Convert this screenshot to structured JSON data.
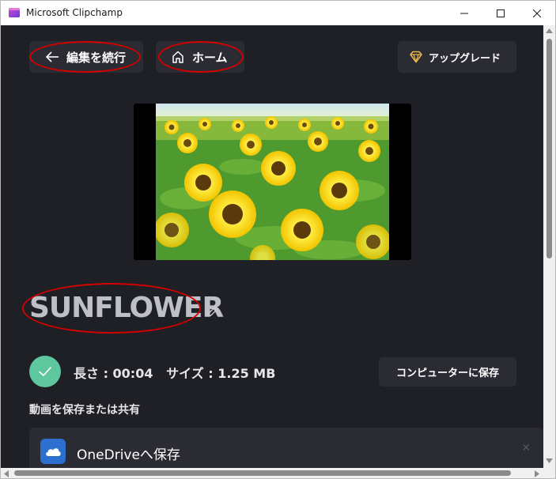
{
  "window": {
    "title": "Microsoft Clipchamp"
  },
  "toolbar": {
    "back_label": "編集を続行",
    "home_label": "ホーム",
    "upgrade_label": "アップグレード"
  },
  "project": {
    "name": "SUNFLOWER"
  },
  "export_info": {
    "meta": "長さ : 00:04   サイズ : 1.25 MB",
    "save_to_computer_label": "コンピューターに保存",
    "share_section_label": "動画を保存または共有"
  },
  "share_options": [
    {
      "label": "OneDriveへ保存",
      "icon": "onedrive-icon"
    }
  ],
  "colors": {
    "background": "#1f1f26",
    "button": "#2b2b33",
    "accent_check": "#5ec79e",
    "annotation": "#d40000",
    "onedrive": "#2c6fcf"
  }
}
